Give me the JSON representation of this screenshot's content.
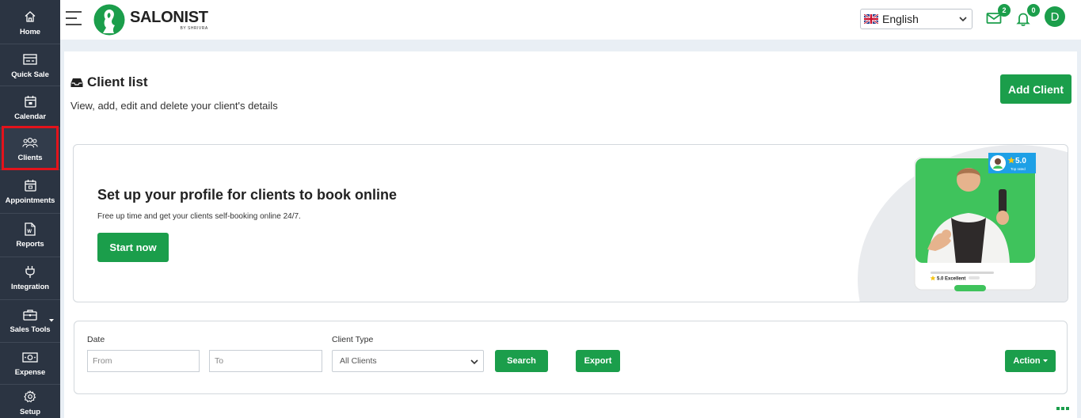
{
  "sidebar": {
    "items": [
      {
        "label": "Home",
        "icon": "home-icon"
      },
      {
        "label": "Quick Sale",
        "icon": "quick-sale-icon"
      },
      {
        "label": "Calendar",
        "icon": "calendar-icon"
      },
      {
        "label": "Clients",
        "icon": "users-icon"
      },
      {
        "label": "Appointments",
        "icon": "appointments-icon"
      },
      {
        "label": "Reports",
        "icon": "reports-icon"
      },
      {
        "label": "Integration",
        "icon": "plug-icon"
      },
      {
        "label": "Sales Tools",
        "icon": "briefcase-icon"
      },
      {
        "label": "Expense",
        "icon": "money-icon"
      },
      {
        "label": "Setup",
        "icon": "gear-icon"
      }
    ]
  },
  "header": {
    "brand": "SALONIST",
    "brand_sub": "BY SHRIVRA",
    "language": "English",
    "messages_count": "2",
    "notifications_count": "0",
    "avatar_initial": "D"
  },
  "page": {
    "title": "Client list",
    "subtitle": "View, add, edit and delete your client's details",
    "add_button": "Add Client"
  },
  "banner": {
    "title": "Set up your profile for clients to book online",
    "description": "Free up time and get your clients self-booking online 24/7.",
    "cta": "Start now",
    "rating_badge": "5.0",
    "rating_badge_sub": "Top rated",
    "rating_line": "5.0 Excellent"
  },
  "filters": {
    "date_label": "Date",
    "from_placeholder": "From",
    "to_placeholder": "To",
    "client_type_label": "Client Type",
    "client_type_value": "All Clients",
    "search_button": "Search",
    "export_button": "Export",
    "action_button": "Action"
  },
  "colors": {
    "accent": "#1b9e4b",
    "sidebar_bg": "#2b3442",
    "highlight": "#e3131b"
  }
}
